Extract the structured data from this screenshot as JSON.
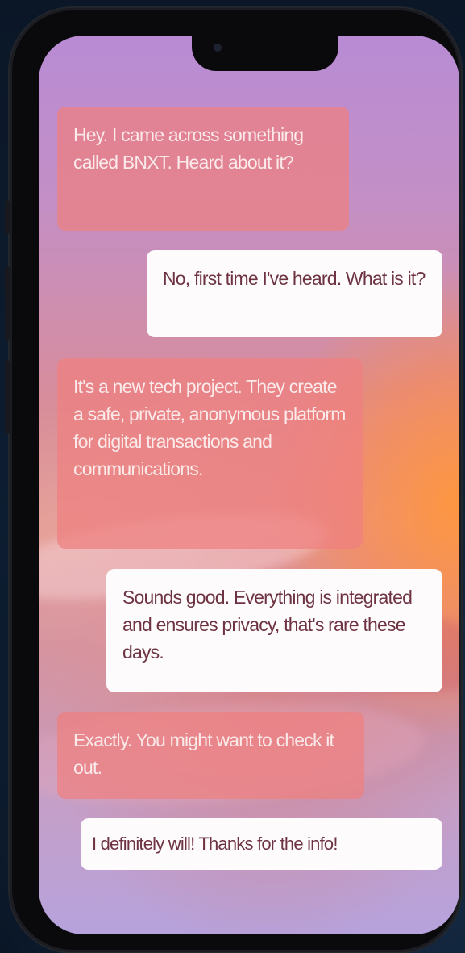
{
  "chat": {
    "messages": [
      {
        "sender": "contact",
        "text": "Hey. I came across something called BNXT. Heard about it?"
      },
      {
        "sender": "me",
        "text": "No, first time I've heard. What is it?"
      },
      {
        "sender": "contact",
        "text": "It's a new tech project. They create a safe, private, anonymous platform for digital transactions and communications."
      },
      {
        "sender": "me",
        "text": "Sounds good. Everything is integrated and ensures privacy, that's rare these days."
      },
      {
        "sender": "contact",
        "text": "Exactly. You might want to check it out."
      },
      {
        "sender": "me",
        "text": "I definitely will! Thanks for the info!"
      }
    ]
  },
  "colors": {
    "incoming_bubble": "#ee8080",
    "outgoing_bubble": "#fdfbfb",
    "outgoing_text": "#6e3342",
    "incoming_text": "#fbeaea",
    "accent_orange": "#ff9640",
    "background_purple": "#b88bd4"
  }
}
